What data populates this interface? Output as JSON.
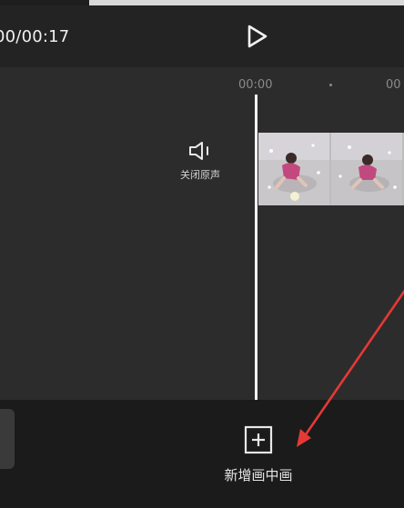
{
  "playback": {
    "time": "00/00:17"
  },
  "ruler": {
    "labels": [
      "00:00",
      "00"
    ]
  },
  "audio": {
    "mute_label": "关闭原声"
  },
  "toolbar": {
    "add_pip_label": "新增画中画"
  },
  "colors": {
    "background": "#1e1e1e",
    "timeline_bg": "#2c2c2c",
    "playhead": "#f2f2f2",
    "annotation_arrow": "#e53935"
  },
  "icons": {
    "play": "play-icon",
    "mute": "speaker-mute-icon",
    "add_pip": "plus-square-icon"
  }
}
